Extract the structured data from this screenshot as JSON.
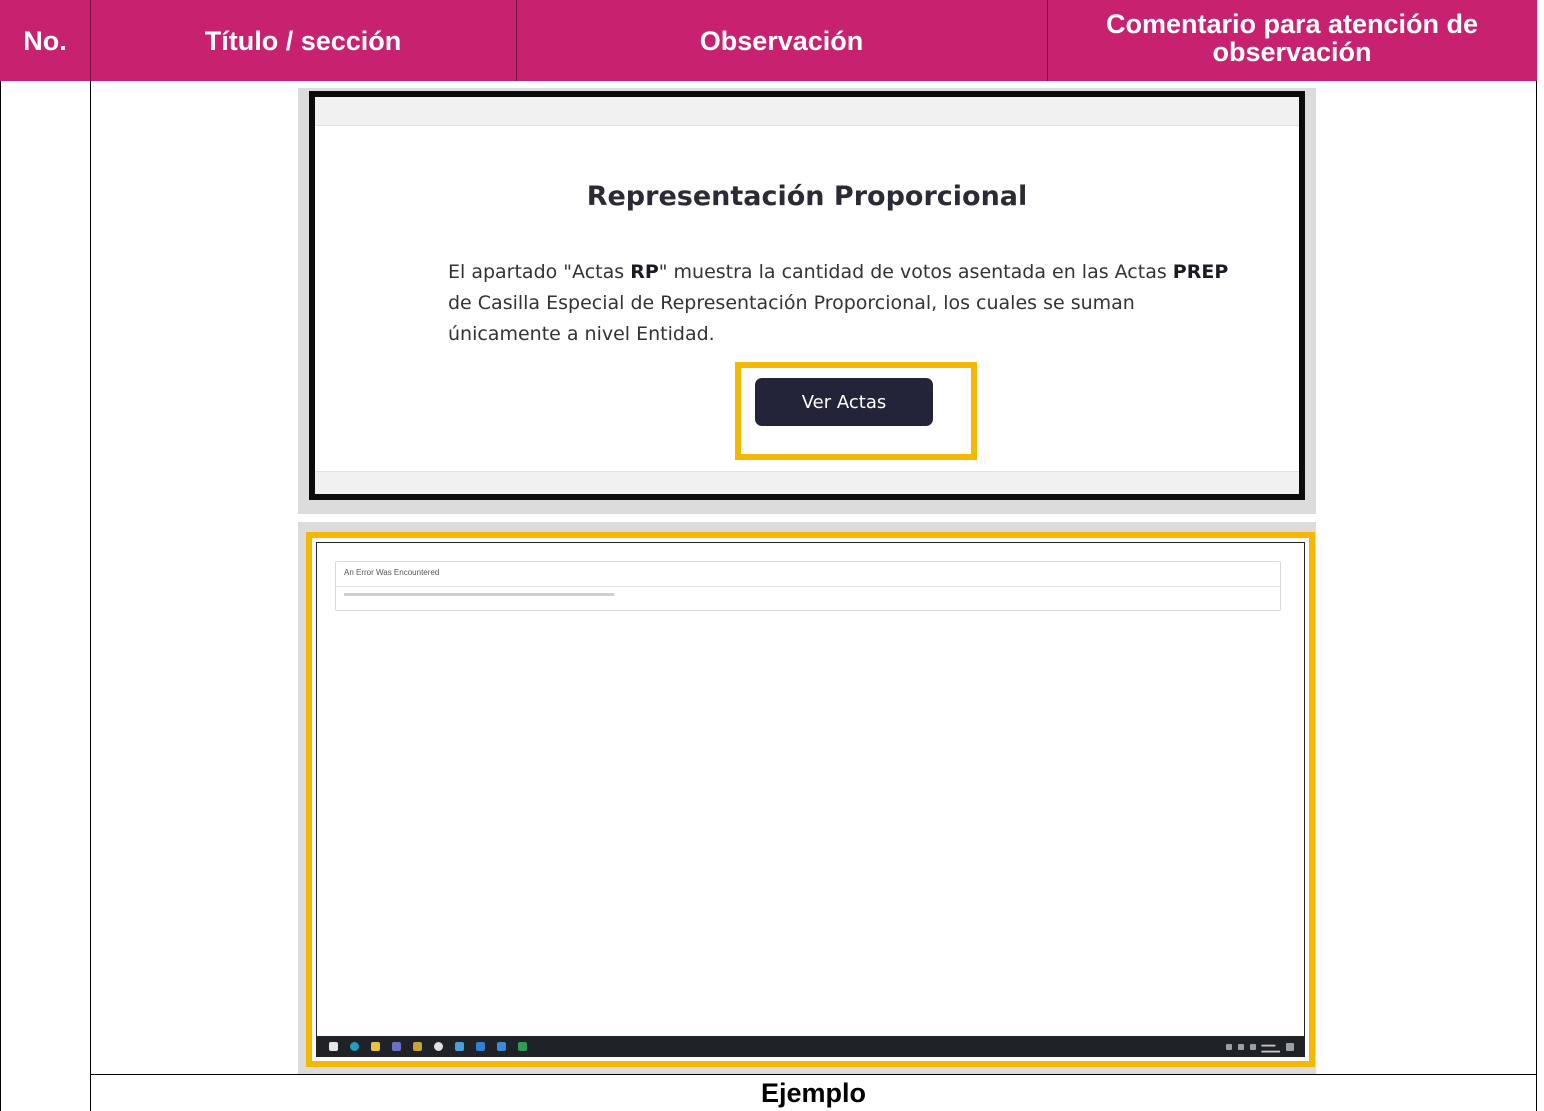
{
  "table": {
    "headers": {
      "no": "No.",
      "titulo": "Título / sección",
      "observacion": "Observación",
      "comentario_line1": "Comentario para atención de",
      "comentario_line2": "observación"
    },
    "caption": "Ejemplo"
  },
  "screenshot_rp": {
    "title": "Representación Proporcional",
    "text_part1": "El apartado \"Actas ",
    "text_bold1": "RP",
    "text_part2": "\" muestra la cantidad de votos asentada en las Actas ",
    "text_bold2": "PREP",
    "text_part3": " de Casilla Especial de Representación Proporcional, los cuales se suman únicamente a nivel Entidad.",
    "button_label": "Ver Actas"
  },
  "screenshot_error": {
    "error_title": "An Error Was Encountered"
  },
  "colors": {
    "header_bg": "#c8216f",
    "highlight": "#f5b800",
    "button_bg": "#23233a"
  }
}
